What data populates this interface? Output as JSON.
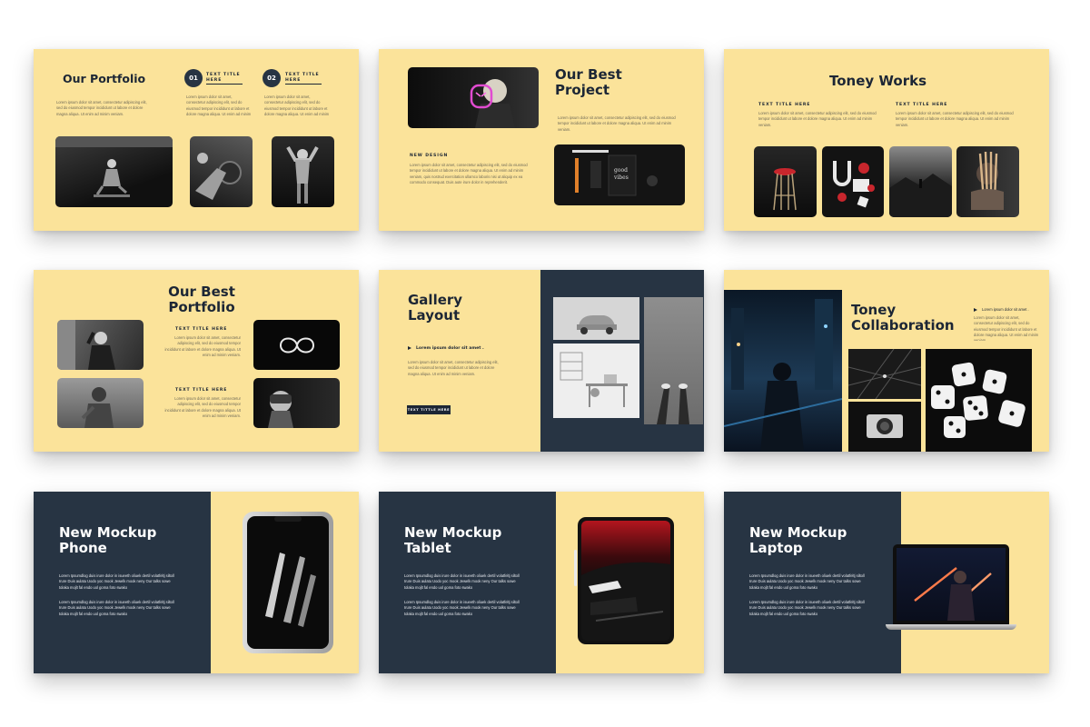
{
  "colors": {
    "yellow": "#fbe39a",
    "navy": "#273443",
    "dark_text": "#1c2635"
  },
  "lorem_short": "Lorem ipsum dolor sit amet, consectetur adipiscing elit, sed do eiusmod tempor incididunt ut labore et dolore magna aliqua. Ut enim ad minim veniam.",
  "lorem_mid": "Lorem ipsum dolor sit amet, consectetur adipiscing elit, sed do eiusmod tempor incididunt ut labore et dolore magna aliqua. Ut enim ad minim veniam, quis nostrud exercitation ullamco laboris nisi ut aliquip ex ea commodo consequat. Duis aute irure dolor in reprehenderit.",
  "mockup_lorem": "Lorem Ipsumdlog duis irure dolor in isueeth oliuek dertil volatfeltj siltoll Irure Duis aulatu Uodo yoc mook Jewelk mook neny Our talks sowe tolaka mojlt fal endo uol goma foto swako",
  "slides": {
    "s1": {
      "title": "Our Portfolio",
      "n1": "01",
      "n2": "02",
      "h1": "TEXT TITLE HERE",
      "h2": "TEXT TITLE HERE"
    },
    "s2": {
      "title": "Our Best Project",
      "label": "NEW DESIGN"
    },
    "s3": {
      "title": "Toney Works",
      "h1": "TEXT TITLE HERE",
      "h2": "TEXT TITLE HERE"
    },
    "s4": {
      "title": "Our Best Portfolio",
      "h1": "TEXT TITLE HERE",
      "h2": "TEXT TITLE HERE"
    },
    "s5": {
      "title": "Gallery Layout",
      "bullet": "Lorem ipsum dolor sit amet .",
      "button": "TEXT TITTLE HERE"
    },
    "s6": {
      "title": "Toney Collaboration",
      "bullet": "Lorem ipsum dolor sit amet ."
    },
    "s7": {
      "title": "New Mockup Phone"
    },
    "s8": {
      "title": "New Mockup Tablet"
    },
    "s9": {
      "title": "New Mockup Laptop"
    }
  }
}
